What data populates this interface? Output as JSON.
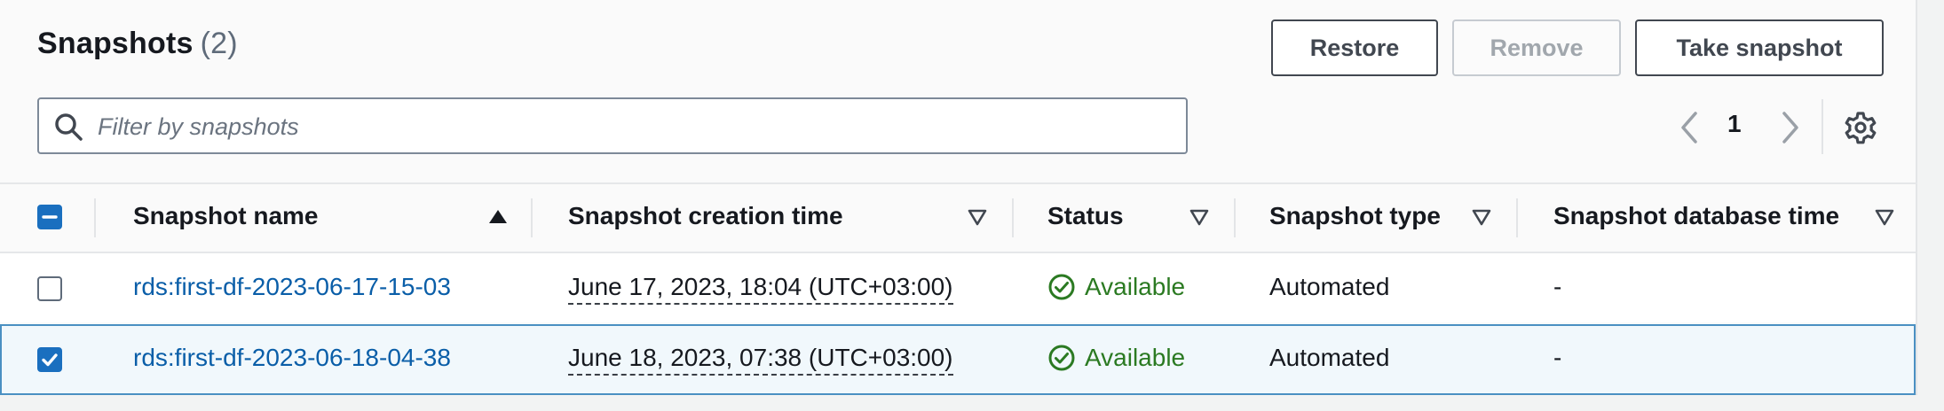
{
  "header": {
    "title": "Snapshots",
    "count": "(2)"
  },
  "actions": {
    "restore": "Restore",
    "remove": "Remove",
    "take_snapshot": "Take snapshot"
  },
  "search": {
    "placeholder": "Filter by snapshots",
    "value": ""
  },
  "pagination": {
    "current_page": "1"
  },
  "columns": [
    "Snapshot name",
    "Snapshot creation time",
    "Status",
    "Snapshot type",
    "Snapshot database time"
  ],
  "rows": [
    {
      "selected": false,
      "name": "rds:first-df-2023-06-17-15-03",
      "creation_time": "June 17, 2023, 18:04 (UTC+03:00)",
      "status": "Available",
      "type": "Automated",
      "database_time": "-"
    },
    {
      "selected": true,
      "name": "rds:first-df-2023-06-18-04-38",
      "creation_time": "June 18, 2023, 07:38 (UTC+03:00)",
      "status": "Available",
      "type": "Automated",
      "database_time": "-"
    }
  ],
  "colors": {
    "link": "#0a5ea8",
    "success": "#2b7a22",
    "selected_border": "#4a90c2",
    "selected_background": "#f1f8fc",
    "checkbox_checked": "#1a6fbf"
  },
  "icons": {
    "search": "search-icon",
    "prev": "chevron-left-icon",
    "next": "chevron-right-icon",
    "settings": "gear-icon",
    "sort_ascending": "caret-up-icon",
    "sort_none": "caret-down-outline-icon",
    "status_ok": "check-circle-icon"
  }
}
